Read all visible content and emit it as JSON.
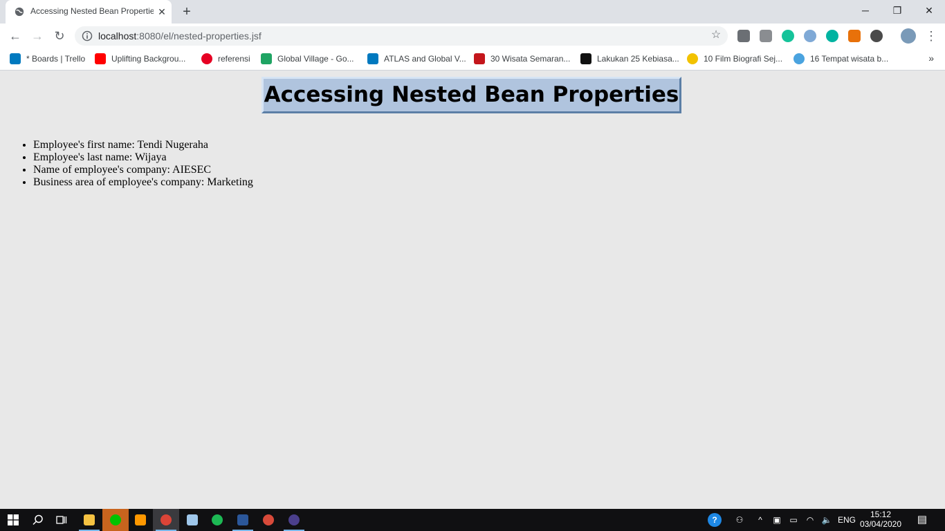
{
  "browser": {
    "tab_title": "Accessing Nested Bean Properties",
    "url_host": "localhost",
    "url_rest": ":8080/el/nested-properties.jsf",
    "window_controls": {
      "minimize": "─",
      "restore": "❐",
      "close": "✕"
    }
  },
  "bookmarks": [
    {
      "label": "* Boards | Trello",
      "icon": "trello-icon",
      "color": "#0079bf"
    },
    {
      "label": "Uplifting Backgrou...",
      "icon": "youtube-icon",
      "color": "#ff0000"
    },
    {
      "label": "referensi",
      "icon": "pinterest-icon",
      "color": "#e60023"
    },
    {
      "label": "Global Village - Go...",
      "icon": "google-drive-icon",
      "color": "#1fa463"
    },
    {
      "label": "ATLAS and Global V...",
      "icon": "trello-icon",
      "color": "#0079bf"
    },
    {
      "label": "30 Wisata Semaran...",
      "icon": "m-icon",
      "color": "#c4161c"
    },
    {
      "label": "Lakukan 25 Kebiasa...",
      "icon": "m-icon",
      "color": "#111111"
    },
    {
      "label": "10 Film Biografi Sej...",
      "icon": "z-icon",
      "color": "#f2c200"
    },
    {
      "label": "16 Tempat wisata b...",
      "icon": "bird-icon",
      "color": "#4aa3df"
    }
  ],
  "page": {
    "heading": "Accessing Nested Bean Properties",
    "items": [
      "Employee's first name: Tendi Nugeraha",
      "Employee's last name: Wijaya",
      "Name of employee's company: AIESEC",
      "Business area of employee's company: Marketing"
    ]
  },
  "taskbar": {
    "language": "ENG",
    "time": "15:12",
    "date": "03/04/2020"
  }
}
